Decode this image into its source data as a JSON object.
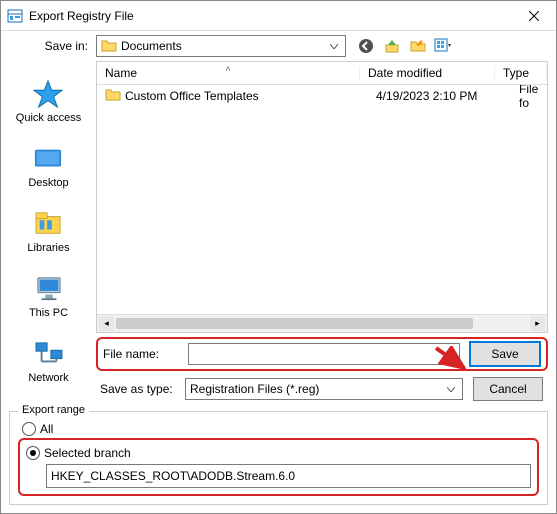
{
  "window": {
    "title": "Export Registry File"
  },
  "toolbar": {
    "save_in_label": "Save in:",
    "current_folder": "Documents"
  },
  "places": [
    {
      "label": "Quick access"
    },
    {
      "label": "Desktop"
    },
    {
      "label": "Libraries"
    },
    {
      "label": "This PC"
    },
    {
      "label": "Network"
    }
  ],
  "columns": {
    "name": "Name",
    "date": "Date modified",
    "type": "Type"
  },
  "rows": [
    {
      "name": "Custom Office Templates",
      "date": "4/19/2023 2:10 PM",
      "type": "File fo"
    }
  ],
  "fields": {
    "file_name_label": "File name:",
    "file_name_value": "",
    "save_as_type_label": "Save as type:",
    "save_as_type_value": "Registration Files (*.reg)"
  },
  "buttons": {
    "save": "Save",
    "cancel": "Cancel"
  },
  "export_range": {
    "legend": "Export range",
    "all_label": "All",
    "selected_label": "Selected branch",
    "selected": "selected_branch",
    "branch_value": "HKEY_CLASSES_ROOT\\ADODB.Stream.6.0"
  }
}
